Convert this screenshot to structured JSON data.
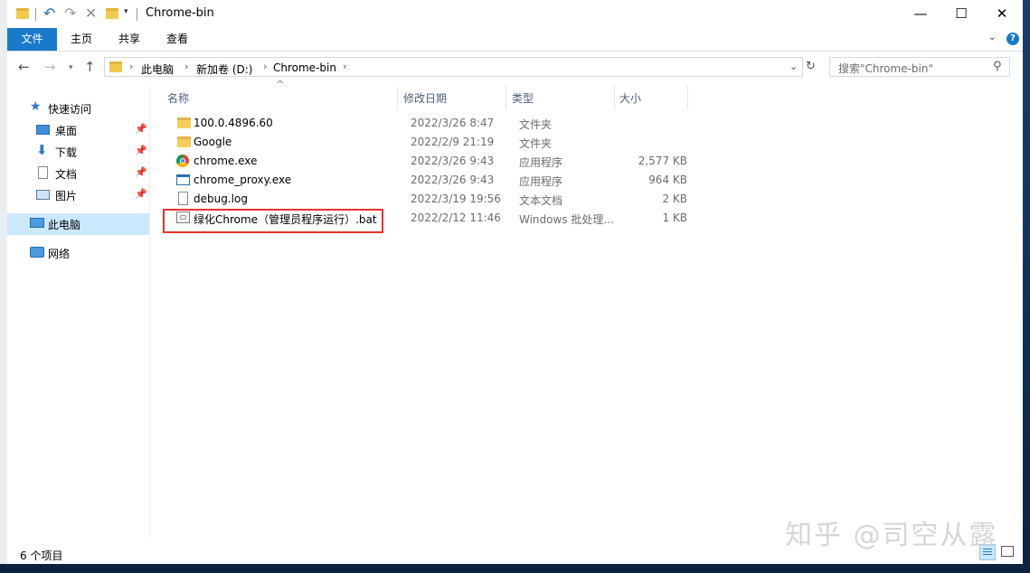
{
  "window": {
    "title": "Chrome-bin"
  },
  "window_controls": {
    "minimize": "—",
    "maximize": "☐",
    "close": "✕"
  },
  "ribbon": {
    "tabs": [
      "文件",
      "主页",
      "共享",
      "查看"
    ]
  },
  "address": {
    "crumbs": [
      "此电脑",
      "新加卷 (D:)",
      "Chrome-bin"
    ]
  },
  "search": {
    "placeholder": "搜索\"Chrome-bin\""
  },
  "navpane": {
    "quick_access": "快速访问",
    "items": [
      "桌面",
      "下载",
      "文档",
      "图片"
    ],
    "this_pc": "此电脑",
    "network": "网络"
  },
  "columns": {
    "name": "名称",
    "modified": "修改日期",
    "type": "类型",
    "size": "大小"
  },
  "files": [
    {
      "name": "100.0.4896.60",
      "modified": "2022/3/26 8:47",
      "type": "文件夹",
      "size": "",
      "icon": "folder-icon"
    },
    {
      "name": "Google",
      "modified": "2022/2/9 21:19",
      "type": "文件夹",
      "size": "",
      "icon": "folder-icon"
    },
    {
      "name": "chrome.exe",
      "modified": "2022/3/26 9:43",
      "type": "应用程序",
      "size": "2,577 KB",
      "icon": "chrome-icon"
    },
    {
      "name": "chrome_proxy.exe",
      "modified": "2022/3/26 9:43",
      "type": "应用程序",
      "size": "964 KB",
      "icon": "app-icon"
    },
    {
      "name": "debug.log",
      "modified": "2022/3/19 19:56",
      "type": "文本文档",
      "size": "2 KB",
      "icon": "text-file-icon"
    },
    {
      "name": "绿化Chrome（管理员程序运行）.bat",
      "modified": "2022/2/12 11:46",
      "type": "Windows 批处理...",
      "size": "1 KB",
      "icon": "batch-file-icon"
    }
  ],
  "status": {
    "item_count": "6 个项目"
  },
  "watermark": "知乎 @司空从露",
  "colors": {
    "file_tab": "#1979ca",
    "highlight_box": "#e8322e",
    "column_header": "#4c607a",
    "selected_nav": "#cce8ff"
  }
}
